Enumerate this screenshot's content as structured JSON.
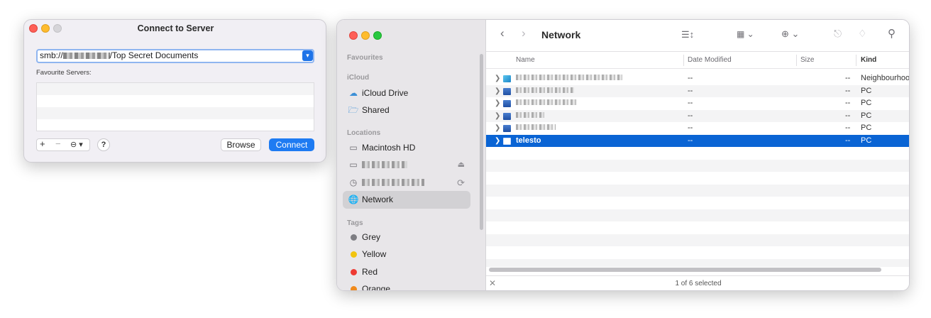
{
  "dialog": {
    "title": "Connect to Server",
    "address_prefix": "smb://",
    "address_suffix": "/Top Secret Documents",
    "favourites_label": "Favourite Servers:",
    "add_label": "+",
    "remove_label": "−",
    "more_label": "⊖ ▾",
    "help_label": "?",
    "browse_label": "Browse",
    "connect_label": "Connect"
  },
  "finder": {
    "title": "Network",
    "sidebar": {
      "favourites_header": "Favourites",
      "icloud_header": "iCloud",
      "icloud_drive": "iCloud Drive",
      "shared": "Shared",
      "locations_header": "Locations",
      "macintosh_hd": "Macintosh HD",
      "network": "Network",
      "tags_header": "Tags",
      "tags": [
        {
          "label": "Grey",
          "color": "#7d7d82"
        },
        {
          "label": "Yellow",
          "color": "#f2c40f"
        },
        {
          "label": "Red",
          "color": "#ee3a33"
        },
        {
          "label": "Orange",
          "color": "#f08a1c"
        }
      ]
    },
    "columns": {
      "name": "Name",
      "date": "Date Modified",
      "size": "Size",
      "kind": "Kind"
    },
    "rows": [
      {
        "name": "",
        "date": "--",
        "size": "--",
        "kind": "Neighbourhood"
      },
      {
        "name": "",
        "date": "--",
        "size": "--",
        "kind": "PC"
      },
      {
        "name": "",
        "date": "--",
        "size": "--",
        "kind": "PC"
      },
      {
        "name": "",
        "date": "--",
        "size": "--",
        "kind": "PC"
      },
      {
        "name": "",
        "date": "--",
        "size": "--",
        "kind": "PC"
      },
      {
        "name": "telesto",
        "date": "--",
        "size": "--",
        "kind": "PC"
      }
    ],
    "status": "1 of 6 selected",
    "selection_color": "#0a64d4",
    "accent_color": "#1e7bf2"
  }
}
